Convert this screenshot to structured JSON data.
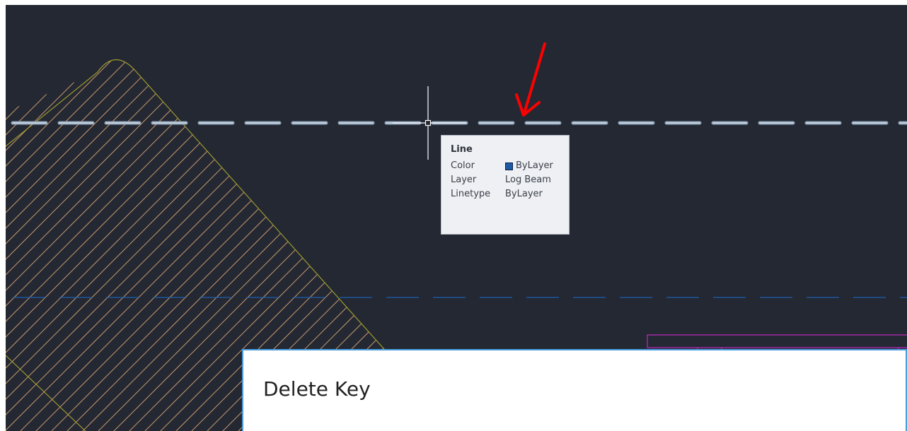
{
  "tooltip": {
    "title": "Line",
    "rows": [
      {
        "label": "Color",
        "value": "ByLayer",
        "swatch_color": "#1c5aa6"
      },
      {
        "label": "Layer",
        "value": "Log Beam"
      },
      {
        "label": "Linetype",
        "value": "ByLayer"
      }
    ]
  },
  "caption": {
    "text": "Delete Key"
  },
  "colors": {
    "canvas_background": "#232833",
    "hatch_line": "#c9976b",
    "hatch_boundary": "#9c9a2c",
    "dashed_line_selected": "#8fa3b8",
    "dashed_line_layer": "#1f5fae",
    "magenta_object": "#c02ac0",
    "arrow": "#ff0000",
    "crosshair": "#ffffff",
    "caption_border": "#4a9fe0"
  },
  "icons": [
    "crosshair-cursor-icon",
    "red-arrow-annotation-icon"
  ]
}
